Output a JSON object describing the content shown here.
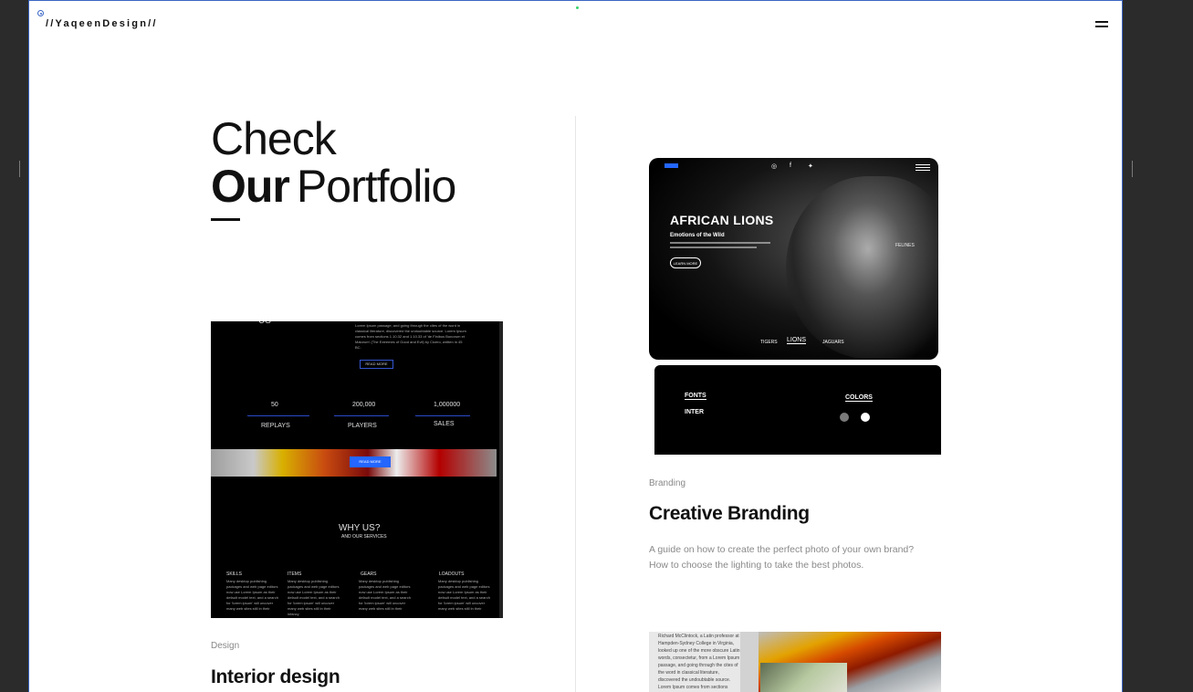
{
  "header": {
    "logo_text": "//YaqeenDesign//"
  },
  "hero": {
    "line1": "Check",
    "line2_bold": "Our",
    "line2_light": "Portfolio"
  },
  "left_card": {
    "screenshot": {
      "about_title": "US",
      "body_text": "Lorem Ipsum passage, and going through the cites of the word in classical literature, discovered the undoubtable source. Lorem Ipsum comes from sections 1.10.32 and 1.10.33 of 'de Finibus Bonorum et Malorum' (The Extremes of Good and Evil) by Cicero, written in 45 BC.",
      "read_more": "READ MORE",
      "stats": [
        {
          "value": "50",
          "label": "REPLAYS"
        },
        {
          "value": "200,000",
          "label": "PLAYERS"
        },
        {
          "value": "1,000000",
          "label": "SALES"
        }
      ],
      "banner_button": "READ MORE",
      "why_title": "WHY US?",
      "why_sub": "AND OUR SERVICES",
      "columns": [
        {
          "title": "SKILLS",
          "text": "Many desktop publishing packages and web page editors now use Lorem Ipsum as their default model text, and a search for 'lorem ipsum' will uncover many web sites still in their"
        },
        {
          "title": "ITEMS",
          "text": "Many desktop publishing packages and web page editors now use Lorem Ipsum as their default model text, and a search for 'lorem ipsum' will uncover many web sites still in their infancy"
        },
        {
          "title": "GEARS",
          "text": "Many desktop publishing packages and web page editors now use Lorem Ipsum as their default model text, and a search for 'lorem ipsum' will uncover many web sites still in their"
        },
        {
          "title": "LOADOUTS",
          "text": "Many desktop publishing packages and web page editors now use Lorem Ipsum as their default model text, and a search for 'lorem ipsum' will uncover many web sites still in their"
        }
      ]
    },
    "category": "Design",
    "title": "Interior design"
  },
  "right_card": {
    "screenshot": {
      "hero_title": "AFRICAN LIONS",
      "hero_sub": "Emotions of the Wild",
      "hero_button": "LEARN MORE",
      "nav": [
        "TIGERS",
        "LIONS",
        "JAGUARS"
      ],
      "side_label": "FELINES",
      "fonts_label": "FONTS",
      "font_name": "INTER",
      "colors_label": "COLORS"
    },
    "category": "Branding",
    "title": "Creative Branding",
    "description": "A guide on how to create the perfect photo of your own brand? How to choose the lighting to take the best photos."
  },
  "third_card": {
    "screenshot_text": "Richard McClintock, a Latin professor at Hampden-Sydney College in Virginia, looked up one of the more obscure Latin words, consectetur, from a Lorem Ipsum passage, and going through the cites of the word in classical literature, discovered the undoubtable source. Lorem Ipsum comes from sections"
  },
  "colors": {
    "frame_border": "#3a66c4",
    "page_background": "#2b2b2b",
    "accent_blue": "#2466ff"
  },
  "icons": [
    "target-icon",
    "menu-icon",
    "instagram-icon",
    "facebook-icon",
    "twitter-icon",
    "search-icon"
  ]
}
